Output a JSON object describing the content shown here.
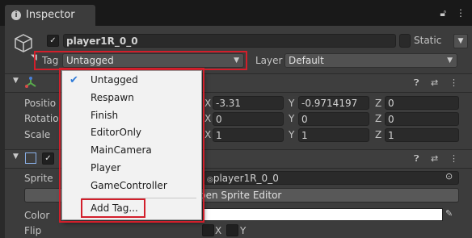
{
  "tab": {
    "icon": "info-icon",
    "title": "Inspector",
    "lock_icon": "lock-icon",
    "menu_icon": "kebab-menu-icon"
  },
  "object": {
    "icon": "gameobject-cube-icon",
    "active_checkbox": "✓",
    "name": "player1R_0_0",
    "static_label": "Static",
    "tag_label": "Tag",
    "tag_value": "Untagged",
    "layer_label": "Layer",
    "layer_value": "Default"
  },
  "tag_menu": {
    "items": [
      "Untagged",
      "Respawn",
      "Finish",
      "EditorOnly",
      "MainCamera",
      "Player",
      "GameController"
    ],
    "selected": "Untagged",
    "add_tag": "Add Tag..."
  },
  "transform": {
    "position_label": "Positio",
    "rotation_label": "Rotatio",
    "scale_label": "Scale",
    "position": {
      "x_label": "X",
      "x": "-3.31",
      "y_label": "Y",
      "y": "-0.9714197",
      "z_label": "Z",
      "z": "0"
    },
    "rotation": {
      "x_label": "X",
      "x": "0",
      "y_label": "Y",
      "y": "0",
      "z_label": "Z",
      "z": "0"
    },
    "scale": {
      "x_label": "X",
      "x": "1",
      "y_label": "Y",
      "y": "1",
      "z_label": "Z",
      "z": "1"
    }
  },
  "sprite_renderer": {
    "sprite_label": "Sprite",
    "sprite_value": "player1R_0_0",
    "open_editor": "pen Sprite Editor",
    "color_label": "Color",
    "flip_label": "Flip",
    "flip_x": "X",
    "flip_y": "Y"
  },
  "colors": {
    "accent_red": "#d21f2b",
    "checkmark_blue": "#2f7bd8"
  }
}
